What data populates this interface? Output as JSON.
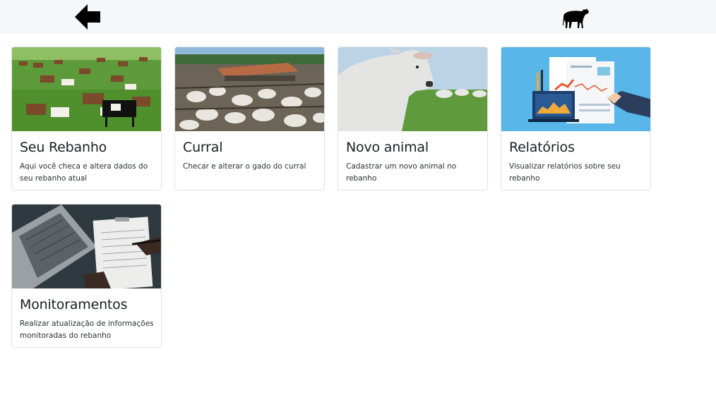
{
  "header": {
    "back_icon": "arrow-left-icon",
    "logo_icon": "cow-icon"
  },
  "cards": [
    {
      "title": "Seu Rebanho",
      "description": "Aqui você checa e altera dados do seu rebanho atual",
      "image": "cows-grazing-photo"
    },
    {
      "title": "Curral",
      "description": "Checar e alterar o gado do curral",
      "image": "corral-cattle-photo"
    },
    {
      "title": "Novo animal",
      "description": "Cadastrar um novo animal no rebanho",
      "image": "white-bull-photo"
    },
    {
      "title": "Relatórios",
      "description": "Visualizar relatórios sobre seu rebanho",
      "image": "reports-illustration"
    },
    {
      "title": "Monitoramentos",
      "description": "Realizar atualização de informações monitoradas do rebanho",
      "image": "laptop-clipboard-photo"
    }
  ],
  "colors": {
    "topbar": "#f6f7f9",
    "card_border": "#dfe2e6",
    "reports_bg": "#58b6e8"
  }
}
